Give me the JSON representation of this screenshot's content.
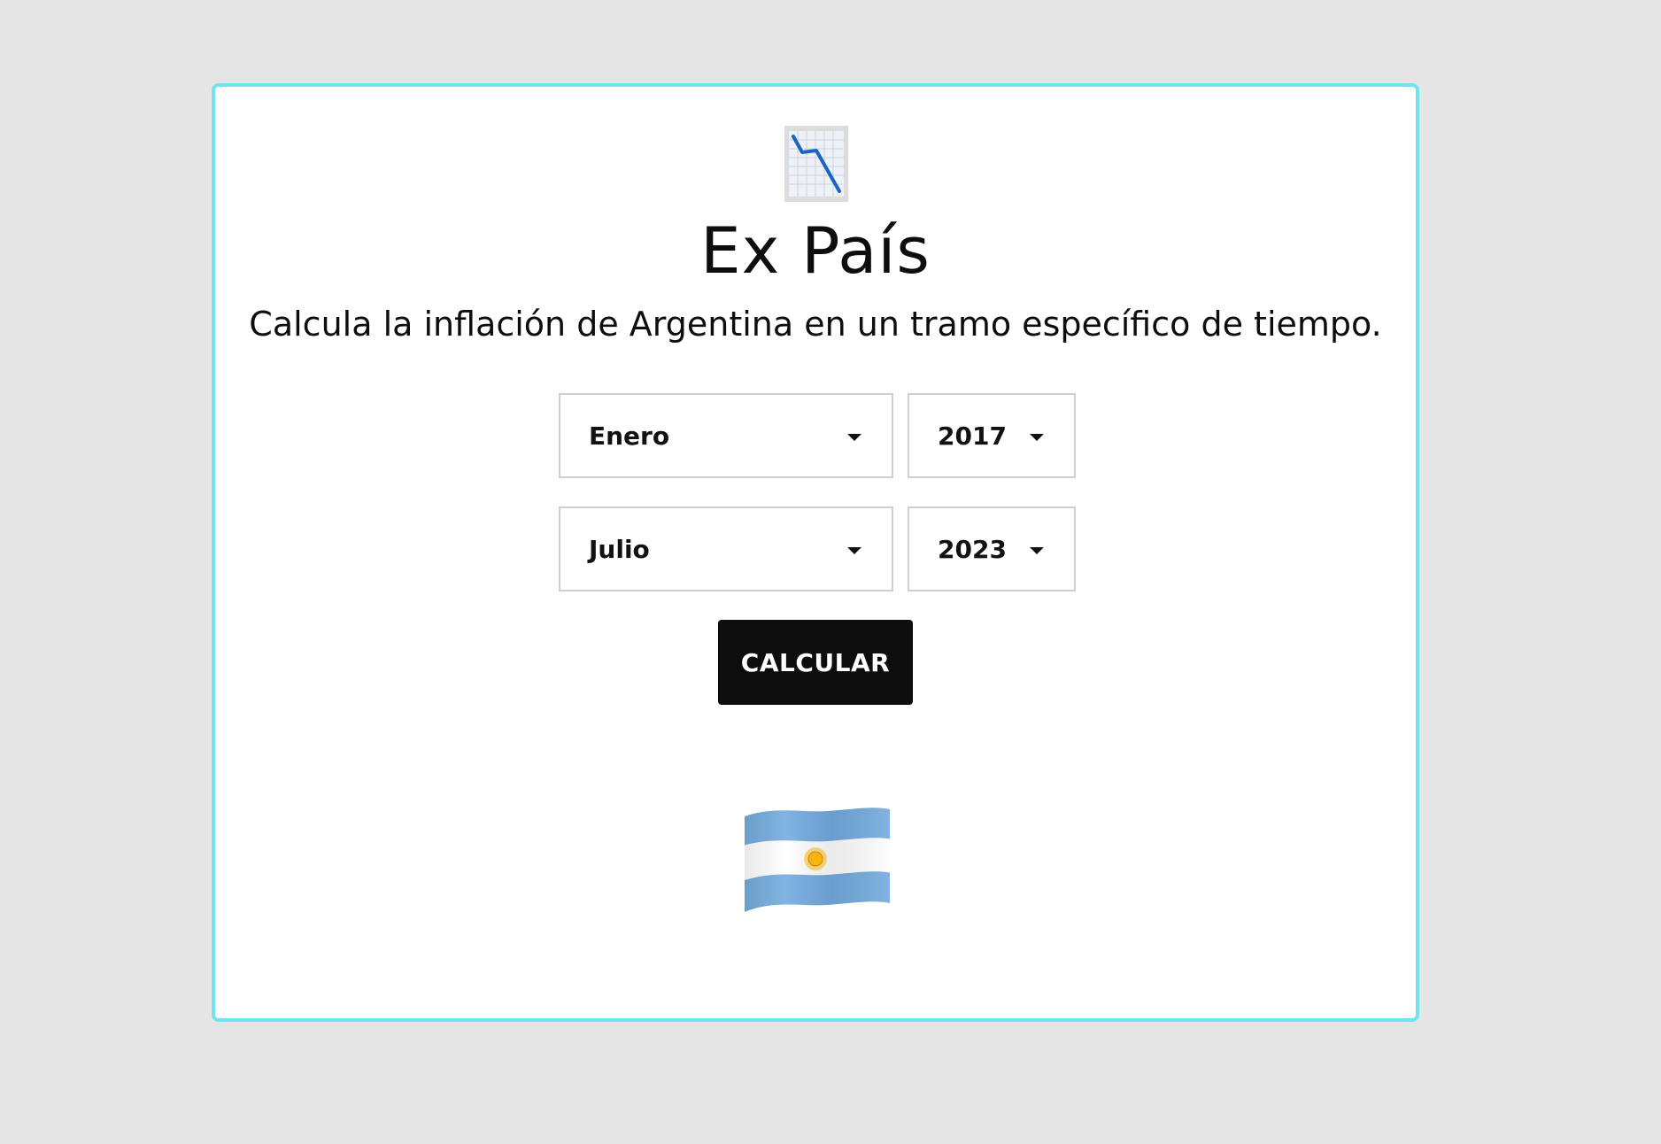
{
  "app": {
    "title": "Ex País",
    "subtitle": "Calcula la inflación de Argentina en un tramo específico de tiempo."
  },
  "icons": {
    "header": "chart-decreasing-icon",
    "footer": "argentina-flag-icon"
  },
  "colors": {
    "background": "#e5e5e5",
    "card_border": "#6fe3ee",
    "button_bg": "#0d0d0d",
    "button_text": "#ffffff",
    "flag_blue": "#74acdf",
    "sun": "#f6b40e"
  },
  "form": {
    "start": {
      "month": "Enero",
      "year": "2017"
    },
    "end": {
      "month": "Julio",
      "year": "2023"
    },
    "submit_label": "CALCULAR"
  }
}
